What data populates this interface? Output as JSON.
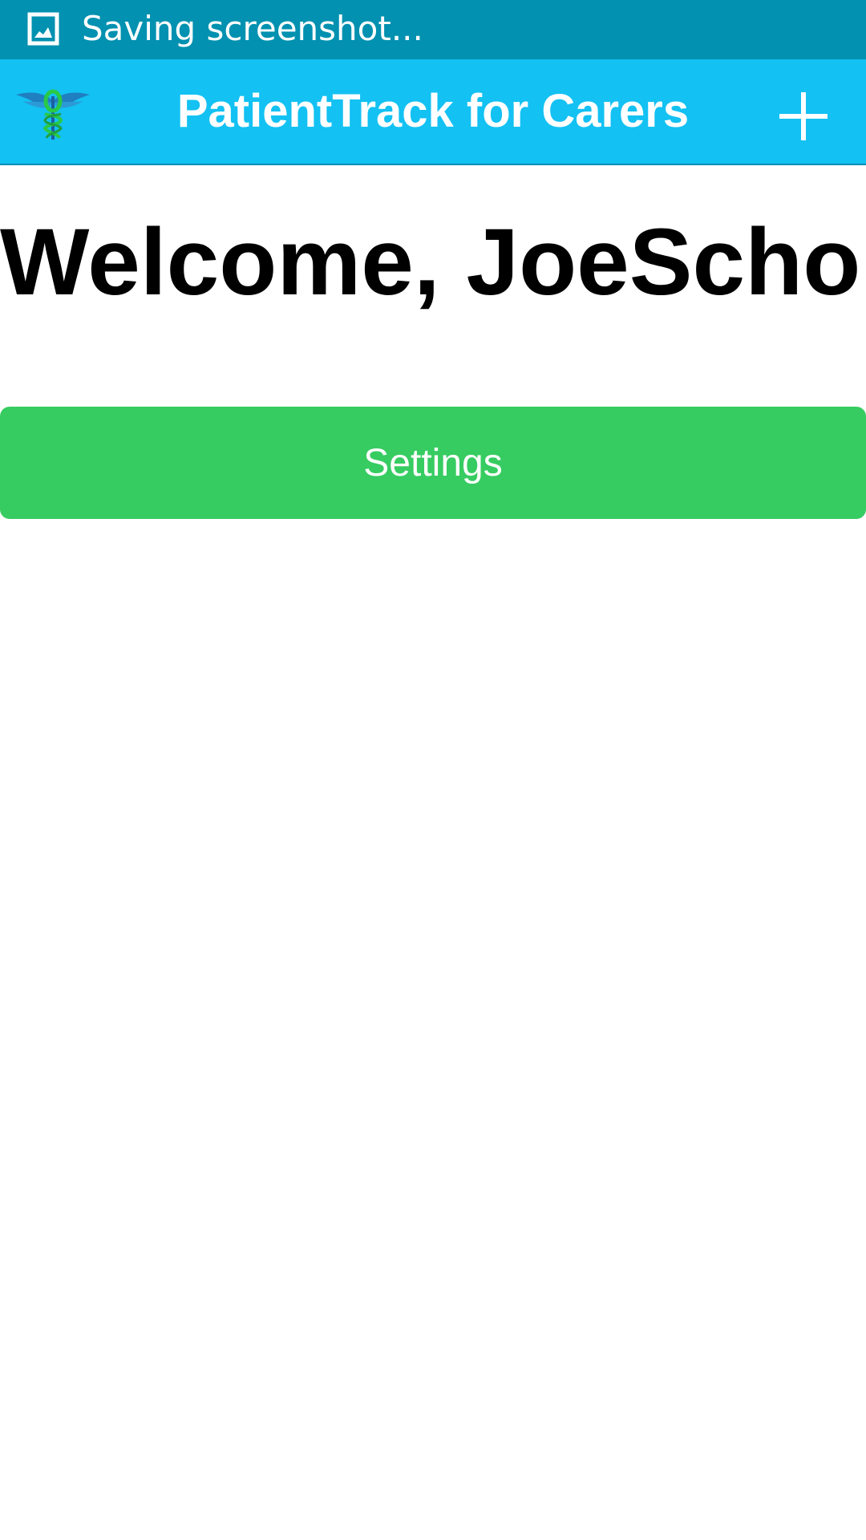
{
  "status_bar": {
    "icon": "screenshot-image-icon",
    "text": "Saving screenshot..."
  },
  "app_bar": {
    "logo_icon": "caduceus-logo-icon",
    "title": "PatientTrack for Carers",
    "add_icon": "plus-icon"
  },
  "main": {
    "welcome_text": "Welcome, JoeScho!",
    "settings_label": "Settings"
  },
  "colors": {
    "status_bar_bg": "#0291b0",
    "app_bar_bg": "#13c1f3",
    "settings_button_bg": "#36cc61",
    "text_on_color": "#ffffff",
    "welcome_text": "#000000"
  }
}
